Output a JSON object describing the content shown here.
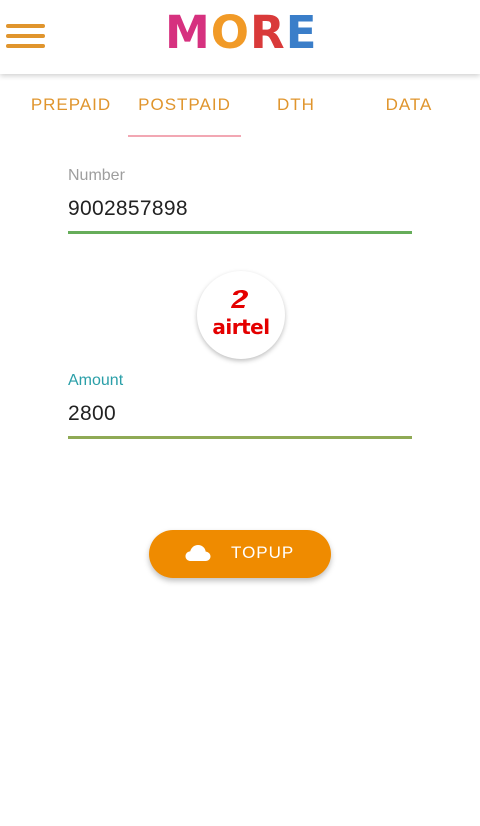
{
  "header": {
    "logo_letters": [
      "M",
      "O",
      "R",
      "E"
    ],
    "logo_colors": [
      "#d6317f",
      "#f19a27",
      "#d93a3a",
      "#3a7ec9"
    ],
    "menu_icon": "hamburger-menu-icon"
  },
  "tabs": [
    {
      "label": "PREPAID",
      "selected": false
    },
    {
      "label": "POSTPAID",
      "selected": true
    },
    {
      "label": "DTH",
      "selected": false
    },
    {
      "label": "DATA",
      "selected": false
    }
  ],
  "number_field": {
    "label": "Number",
    "value": "9002857898"
  },
  "operator": {
    "name": "airtel",
    "icon": "airtel-logo-icon"
  },
  "amount_field": {
    "label": "Amount",
    "value": "2800"
  },
  "topup_button": {
    "label": "TOPUP",
    "icon": "cloud-icon"
  },
  "colors": {
    "accent": "#e0952d",
    "button": "#ef8b00",
    "number_label": "#9e9e9e",
    "amount_label": "#2a9fa8",
    "underline": "#66ad5a",
    "amount_underline": "#8faa55",
    "tab_indicator": "#f2a7b3",
    "brand_red": "#e40000"
  }
}
